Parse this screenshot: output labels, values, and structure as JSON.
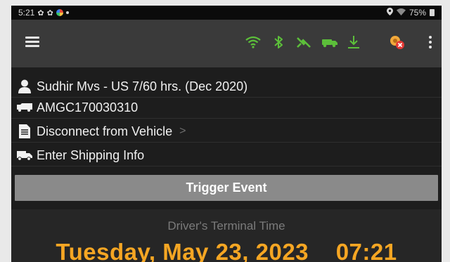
{
  "status_bar": {
    "time": "5:21",
    "battery": "75%"
  },
  "app_bar": {
    "icons": [
      "menu-icon",
      "wifi-icon",
      "bluetooth-icon",
      "gps-icon",
      "vehicle-icon",
      "download-icon",
      "alert-icon",
      "more-vert-icon"
    ],
    "accent_color": "#5cbf3a",
    "alert_color": "#e53935"
  },
  "driver": {
    "name_line": "Sudhir Mvs - US 7/60 hrs. (Dec 2020)",
    "vehicle_id": "AMGC170030310"
  },
  "menu": {
    "disconnect_label": "Disconnect from Vehicle",
    "shipping_label": "Enter Shipping Info"
  },
  "trigger_button": {
    "label": "Trigger Event"
  },
  "terminal": {
    "label": "Driver's Terminal Time",
    "datetime": "Tuesday, May 23, 2023    07:21"
  }
}
